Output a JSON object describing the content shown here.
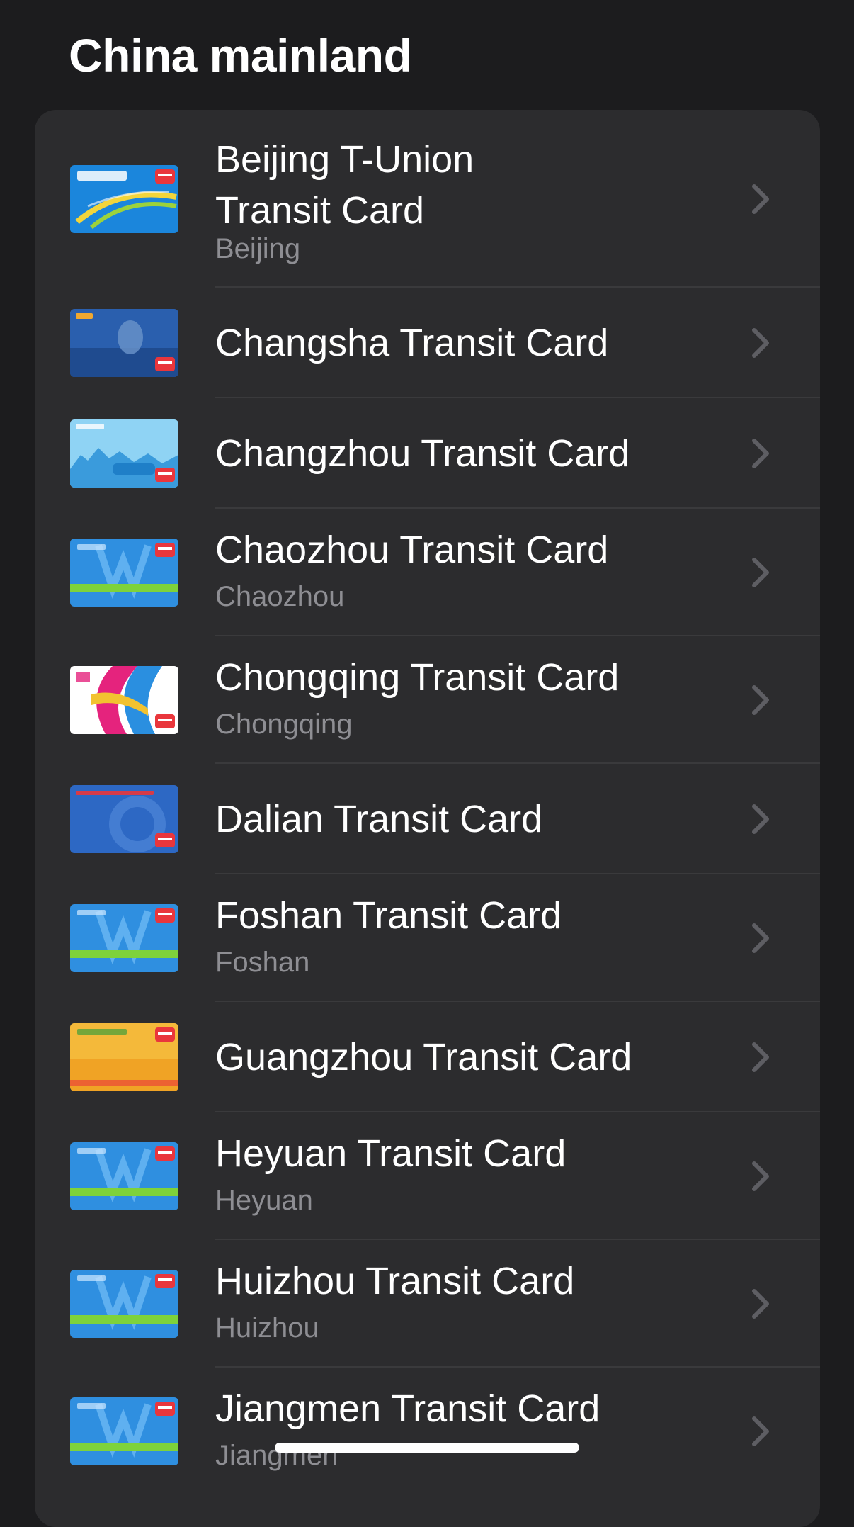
{
  "section": {
    "title": "China mainland"
  },
  "cards": [
    {
      "title_lines": [
        "Beijing T-Union",
        "Transit Card"
      ],
      "subtitle": "Beijing",
      "art": "beijing-card-art"
    },
    {
      "title_lines": [
        "Changsha Transit Card"
      ],
      "subtitle": "",
      "art": "changsha-card-art"
    },
    {
      "title_lines": [
        "Changzhou Transit Card"
      ],
      "subtitle": "",
      "art": "changzhou-card-art"
    },
    {
      "title_lines": [
        "Chaozhou Transit Card"
      ],
      "subtitle": "Chaozhou",
      "art": "guangdong-lingnan-card-art"
    },
    {
      "title_lines": [
        "Chongqing Transit Card"
      ],
      "subtitle": "Chongqing",
      "art": "chongqing-card-art"
    },
    {
      "title_lines": [
        "Dalian Transit Card"
      ],
      "subtitle": "",
      "art": "dalian-card-art"
    },
    {
      "title_lines": [
        "Foshan Transit Card"
      ],
      "subtitle": "Foshan",
      "art": "guangdong-lingnan-card-art"
    },
    {
      "title_lines": [
        "Guangzhou Transit Card"
      ],
      "subtitle": "",
      "art": "guangzhou-card-art"
    },
    {
      "title_lines": [
        "Heyuan Transit Card"
      ],
      "subtitle": "Heyuan",
      "art": "guangdong-lingnan-card-art"
    },
    {
      "title_lines": [
        "Huizhou Transit Card"
      ],
      "subtitle": "Huizhou",
      "art": "guangdong-lingnan-card-art"
    },
    {
      "title_lines": [
        "Jiangmen Transit Card"
      ],
      "subtitle": "Jiangmen",
      "art": "guangdong-lingnan-card-art"
    }
  ],
  "icons": {
    "disclosure": "chevron-right-icon"
  },
  "colors": {
    "background": "#1c1c1e",
    "list_background": "#2c2c2e",
    "primary_text": "#ffffff",
    "secondary_text": "#8e8e93",
    "separator": "#3a3a3c",
    "chevron": "#5e5e63"
  }
}
